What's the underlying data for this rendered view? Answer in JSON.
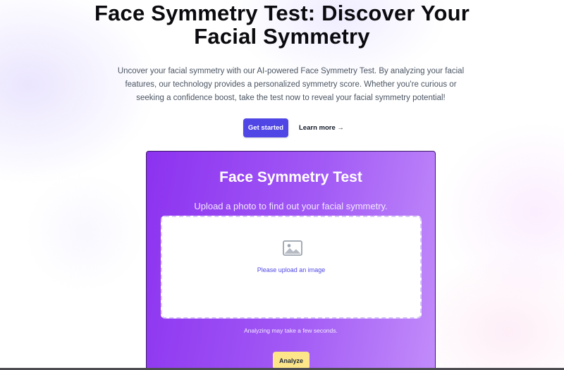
{
  "hero": {
    "title_line1": "Face Symmetry Test: Discover Your",
    "title_line2": "Facial Symmetry",
    "description_lines": [
      "Uncover your facial symmetry with our AI-powered Face Symmetry Test. By analyzing your facial",
      "features, our technology provides a personalized symmetry score. Whether you're curious or",
      "seeking a confidence boost, take the test now to reveal your facial symmetry potential!"
    ],
    "primary_cta": "Get started",
    "secondary_cta": "Learn more →"
  },
  "tool": {
    "title": "Face Symmetry Test",
    "subtitle": "Upload a photo to find out your facial symmetry.",
    "upload_prompt": "Please upload an image",
    "upload_icon": "image-icon",
    "note": "Analyzing may take a few seconds.",
    "analyze_label": "Analyze"
  },
  "colors": {
    "primary": "#4f46e5",
    "card_gradient_start": "#8c32f0",
    "card_gradient_end": "#c28cfa",
    "analyze_button": "#fde68a"
  }
}
